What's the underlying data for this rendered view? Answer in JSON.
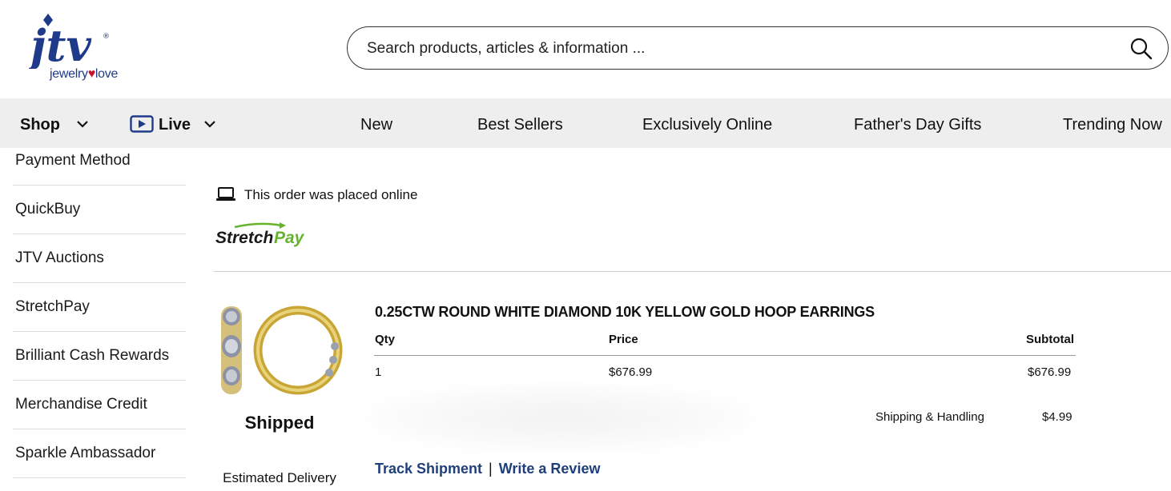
{
  "brand": {
    "logo_text": "jtv",
    "tagline_left": "jewelry",
    "tagline_right": "love",
    "primary_color": "#1f3a8a",
    "accent_color": "#c8102e"
  },
  "search": {
    "placeholder": "Search products, articles & information ...",
    "icon": "search-icon"
  },
  "nav": {
    "shop": "Shop",
    "live": "Live",
    "items": [
      "New",
      "Best Sellers",
      "Exclusively Online",
      "Father's Day Gifts",
      "Trending Now"
    ]
  },
  "sidebar": {
    "items": [
      "Payment Method",
      "QuickBuy",
      "JTV Auctions",
      "StretchPay",
      "Brilliant Cash Rewards",
      "Merchandise Credit",
      "Sparkle Ambassador"
    ]
  },
  "order": {
    "placed_text": "This order was placed online",
    "payment_logo_left": "Stretch",
    "payment_logo_right": "Pay",
    "status": "Shipped",
    "estimated_delivery": "Estimated Delivery",
    "product_title": "0.25CTW ROUND WHITE DIAMOND 10K YELLOW GOLD HOOP EARRINGS",
    "table": {
      "headers": {
        "qty": "Qty",
        "price": "Price",
        "subtotal": "Subtotal"
      },
      "row": {
        "qty": "1",
        "price": "$676.99",
        "subtotal": "$676.99"
      }
    },
    "shipping_label": "Shipping & Handling",
    "shipping_value": "$4.99",
    "track_link": "Track Shipment",
    "separator": "|",
    "review_link": "Write a Review"
  }
}
